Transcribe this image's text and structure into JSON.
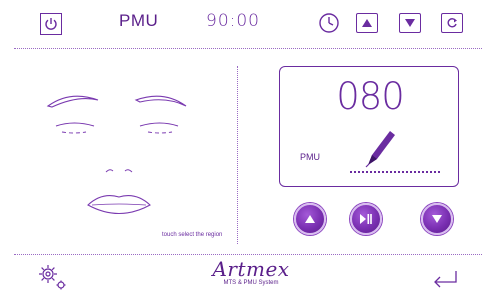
{
  "topbar": {
    "mode_label": "PMU",
    "timer": "90:00"
  },
  "panel": {
    "speed_value": "080",
    "mode_label": "PMU"
  },
  "face": {
    "hint": "touch select the region"
  },
  "brand": {
    "name": "Artmex",
    "subtitle": "MTS & PMU System"
  },
  "icons": {
    "power": "power-icon",
    "clock": "clock-icon",
    "up": "arrow-up-icon",
    "down": "arrow-down-icon",
    "reset": "refresh-icon",
    "pen": "pen-icon",
    "play_pause": "play-pause-icon",
    "settings": "gear-icon",
    "back": "return-icon"
  },
  "colors": {
    "accent": "#6a2ca0",
    "button_fill": "#7a2fb2",
    "background": "#ffffff"
  }
}
